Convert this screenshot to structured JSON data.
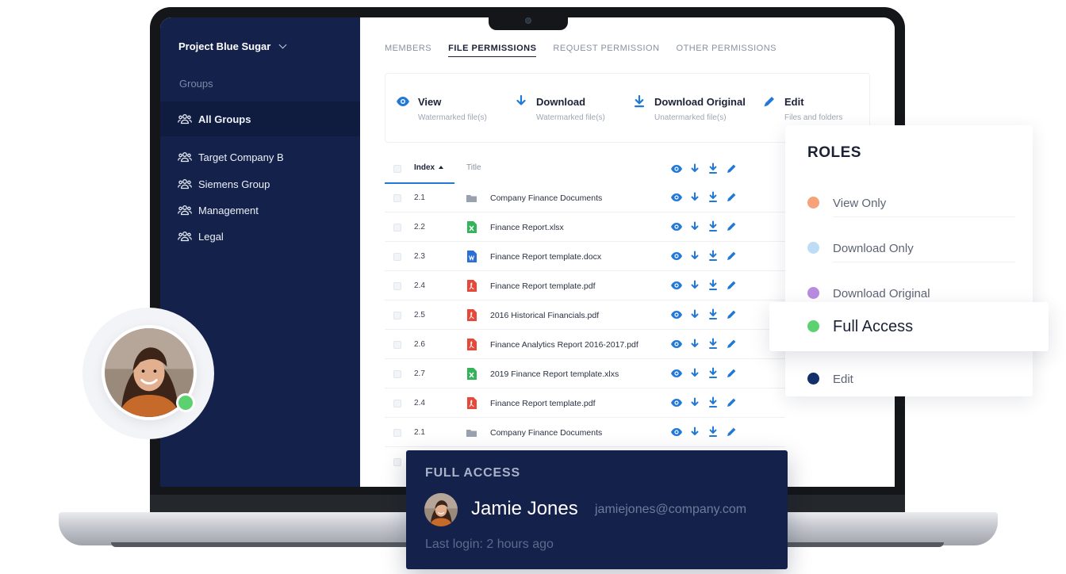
{
  "sidebar": {
    "project": "Project Blue Sugar",
    "groups_heading": "Groups",
    "active_item": "All Groups",
    "items": [
      "Target Company B",
      "Siemens Group",
      "Management",
      "Legal"
    ]
  },
  "tabs": [
    "MEMBERS",
    "FILE PERMISSIONS",
    "REQUEST PERMISSION",
    "OTHER PERMISSIONS"
  ],
  "active_tab": "FILE PERMISSIONS",
  "permissions": [
    {
      "name": "View",
      "sub": "Watermarked file(s)",
      "icon": "eye-icon"
    },
    {
      "name": "Download",
      "sub": "Watermarked file(s)",
      "icon": "download-icon"
    },
    {
      "name": "Download Original",
      "sub": "Unatermarked file(s)",
      "icon": "download-original-icon"
    },
    {
      "name": "Edit",
      "sub": "Files and folders",
      "icon": "pencil-icon"
    }
  ],
  "table": {
    "col_index": "Index",
    "col_title": "Title",
    "rows": [
      {
        "index": "2.1",
        "title": "Company Finance Documents",
        "type": "folder"
      },
      {
        "index": "2.2",
        "title": "Finance Report.xlsx",
        "type": "excel"
      },
      {
        "index": "2.3",
        "title": "Finance Report template.docx",
        "type": "word"
      },
      {
        "index": "2.4",
        "title": "Finance Report template.pdf",
        "type": "pdf"
      },
      {
        "index": "2.5",
        "title": "2016 Historical Financials.pdf",
        "type": "pdf"
      },
      {
        "index": "2.6",
        "title": "Finance Analytics Report 2016-2017.pdf",
        "type": "pdf"
      },
      {
        "index": "2.7",
        "title": "2019 Finance Report template.xlxs",
        "type": "excel"
      },
      {
        "index": "2.4",
        "title": "Finance Report template.pdf",
        "type": "pdf"
      },
      {
        "index": "2.1",
        "title": "Company Finance Documents",
        "type": "folder"
      }
    ]
  },
  "roles": {
    "title": "ROLES",
    "items": [
      {
        "label": "View Only",
        "color": "#f6a27a"
      },
      {
        "label": "Download Only",
        "color": "#bfdcf7"
      },
      {
        "label": "Download Original",
        "color": "#b98be0"
      },
      {
        "label": "Full Access",
        "color": "#5cd16f"
      },
      {
        "label": "Edit",
        "color": "#13306b"
      }
    ],
    "selected": "Full Access"
  },
  "user_card": {
    "role": "FULL ACCESS",
    "name": "Jamie Jones",
    "email": "jamiejones@company.com",
    "last_login": "Last login: 2 hours ago"
  },
  "colors": {
    "sidebar": "#13214b",
    "accent": "#2178d6",
    "online": "#5cd16f"
  }
}
